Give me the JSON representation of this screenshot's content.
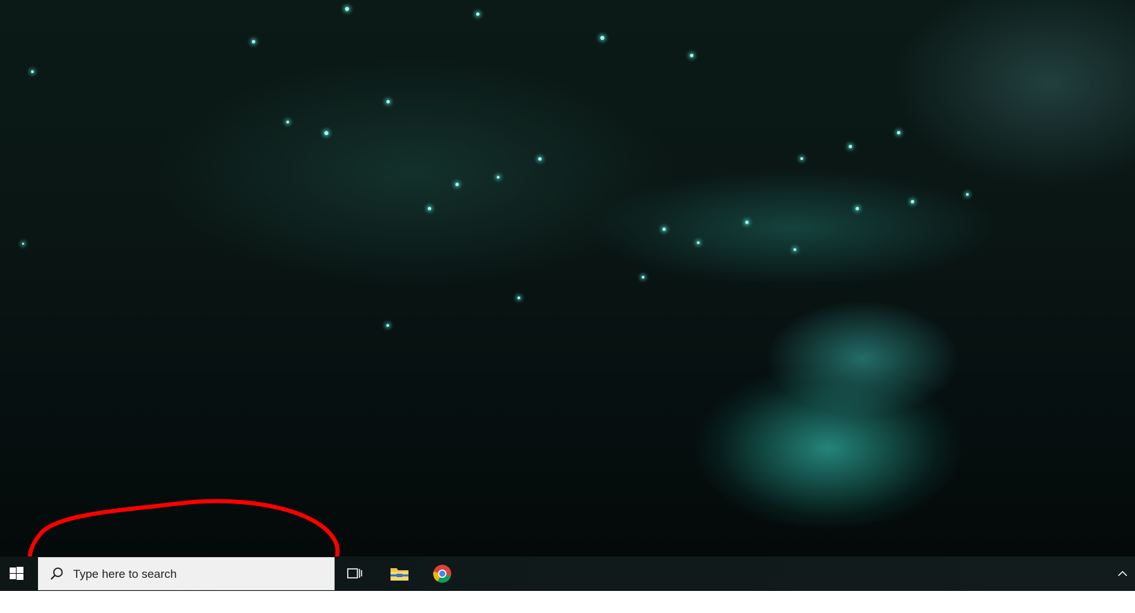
{
  "taskbar": {
    "search": {
      "placeholder": "Type here to search"
    },
    "icons": [
      "windows-start-icon",
      "search-icon",
      "task-view-icon",
      "file-explorer-icon",
      "chrome-icon",
      "chevron-up-icon"
    ]
  },
  "colors": {
    "annotation": "#ff0000",
    "taskbar": "#101a1a",
    "search_bg": "#f0f0f0"
  }
}
